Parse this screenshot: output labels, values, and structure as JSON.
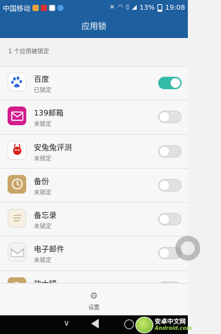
{
  "status_bar": {
    "carrier": "中国移动",
    "battery": "13%",
    "time": "19:08",
    "notification_icons": [
      "weibo-icon",
      "z-app-icon",
      "image-icon",
      "app-circle-icon"
    ],
    "system_icons": [
      "mute-icon",
      "wifi-icon",
      "sim-icon",
      "signal-icon",
      "battery-icon"
    ]
  },
  "header": {
    "title": "应用锁"
  },
  "summary": "1 个应用被锁定",
  "apps": [
    {
      "name": "百度",
      "status": "已锁定",
      "locked": true,
      "icon": "baidu-paw-icon"
    },
    {
      "name": "139邮箱",
      "status": "未锁定",
      "locked": false,
      "icon": "mail-139-icon"
    },
    {
      "name": "安兔兔评测",
      "status": "未锁定",
      "locked": false,
      "icon": "antutu-icon"
    },
    {
      "name": "备份",
      "status": "未锁定",
      "locked": false,
      "icon": "backup-icon"
    },
    {
      "name": "备忘录",
      "status": "未锁定",
      "locked": false,
      "icon": "memo-icon"
    },
    {
      "name": "电子邮件",
      "status": "未锁定",
      "locked": false,
      "icon": "email-icon"
    },
    {
      "name": "放大镜",
      "status": "",
      "locked": false,
      "icon": "magnifier-icon"
    }
  ],
  "bottom_bar": {
    "settings_label": "设置",
    "icon": "gear-icon"
  },
  "watermark": {
    "cn": "安卓中文网",
    "en": "Android.com"
  },
  "colors": {
    "header_bg": "#1e5fa0",
    "toggle_on": "#33bca8",
    "toggle_off": "#e1e1e1"
  }
}
